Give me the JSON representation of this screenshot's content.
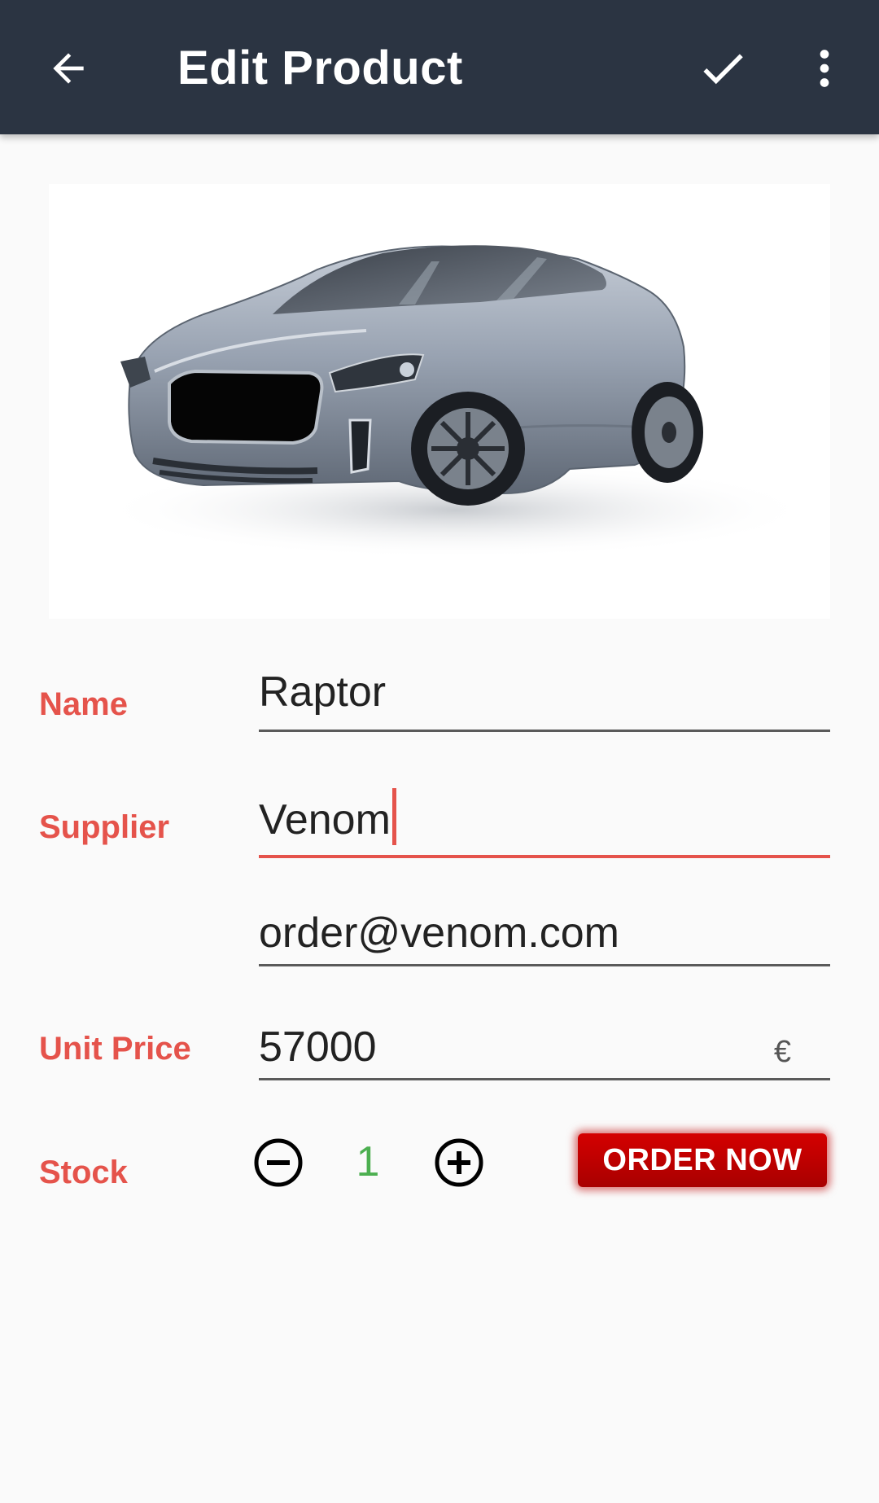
{
  "appbar": {
    "title": "Edit Product",
    "back_icon": "arrow-left-icon",
    "save_icon": "check-icon",
    "more_icon": "more-vert-icon",
    "background_color": "#2b3442"
  },
  "product": {
    "image_icon": "car-image"
  },
  "form": {
    "name_label": "Name",
    "name_value": "Raptor",
    "supplier_label": "Supplier",
    "supplier_value": "Venom",
    "email_value": "order@venom.com",
    "price_label": "Unit Price",
    "price_value": "57000",
    "currency": "€",
    "stock_label": "Stock",
    "stock_value": "1",
    "order_button_label": "ORDER NOW"
  },
  "colors": {
    "label_color": "#e5534b",
    "stock_color": "#4caf50",
    "order_button_color": "#c80000"
  }
}
